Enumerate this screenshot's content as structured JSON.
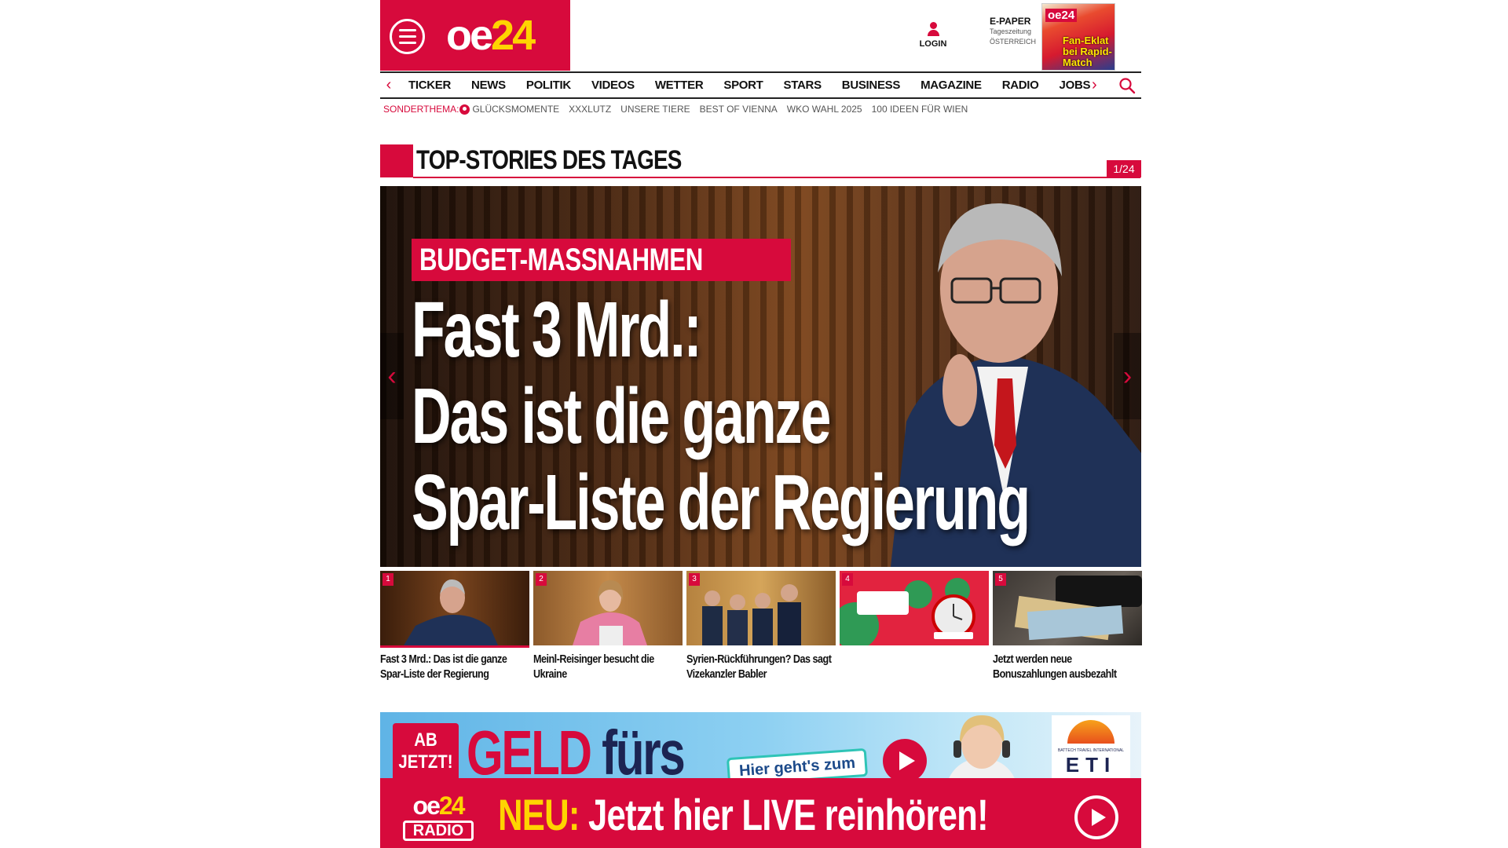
{
  "header": {
    "logo_oe": "oe",
    "logo_24": "24",
    "login_label": "LOGIN",
    "epaper_title": "E-PAPER",
    "epaper_sub1": "Tageszeitung",
    "epaper_sub2": "ÖSTERREICH",
    "epaper_cover_logo": "oe24",
    "epaper_cover_headline": "Fan-Eklat bei Rapid-Match"
  },
  "nav": {
    "items": [
      "TICKER",
      "NEWS",
      "POLITIK",
      "VIDEOS",
      "WETTER",
      "SPORT",
      "STARS",
      "BUSINESS",
      "MAGAZINE",
      "RADIO",
      "JOBS"
    ],
    "left_arrow": "‹",
    "right_arrow": "›"
  },
  "subnav": {
    "label": "SONDERTHEMA:",
    "items": [
      "GLÜCKSMOMENTE",
      "XXXLUTZ",
      "UNSERE TIERE",
      "BEST OF VIENNA",
      "WKO WAHL 2025",
      "100 IDEEN FÜR WIEN"
    ]
  },
  "section": {
    "title": "TOP-STORIES DES TAGES",
    "counter": "1/24"
  },
  "hero": {
    "tag": "BUDGET-MASSNAHMEN",
    "title_lines": [
      "Fast 3 Mrd.:",
      "Das ist die ganze",
      "Spar-Liste der Regierung"
    ],
    "prev": "‹",
    "next": "›"
  },
  "thumbs": [
    {
      "num": "1",
      "text": "Fast 3 Mrd.: Das ist die ganze Spar-Liste der Regierung"
    },
    {
      "num": "2",
      "text": "Meinl-Reisinger besucht die Ukraine"
    },
    {
      "num": "3",
      "text": "Syrien-Rückführungen? Das sagt Vizekanzler Babler"
    },
    {
      "num": "4",
      "text": ""
    },
    {
      "num": "5",
      "text": "Jetzt werden neue Bonuszahlungen ausbezahlt"
    }
  ],
  "ad": {
    "badge_line1": "AB",
    "badge_line2": "JETZT!",
    "headline_red": "GELD",
    "headline_dark": "fürs",
    "cta": "Hier geht's zum",
    "logo": "ETI",
    "logo_small": "BATTECH TRAVEL INTERNATIONAL"
  },
  "radio": {
    "logo_oe": "oe",
    "logo_24": "24",
    "logo_label": "RADIO",
    "neu": "NEU:",
    "text": " Jetzt hier LIVE reinhören!"
  },
  "colors": {
    "brand_red": "#d70a3c",
    "brand_yellow": "#ffd400"
  }
}
